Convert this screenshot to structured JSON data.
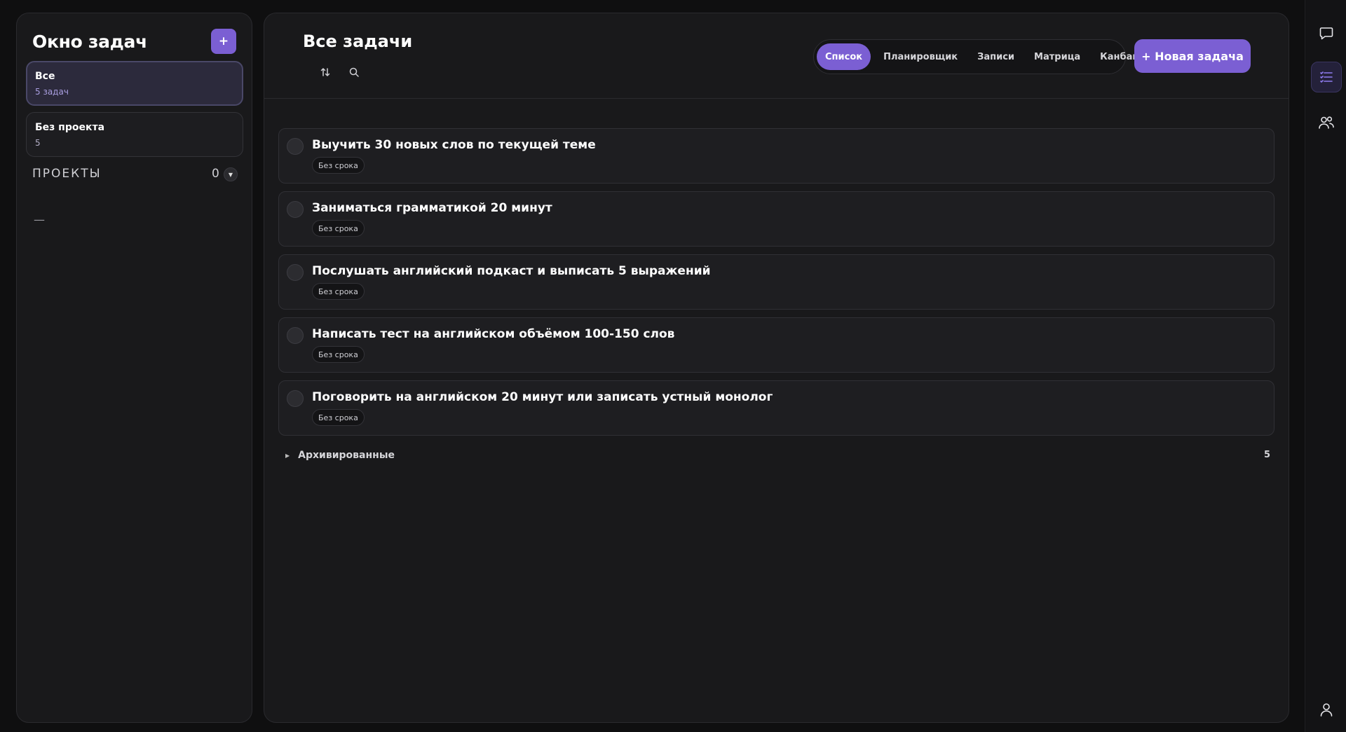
{
  "sidebar": {
    "title": "Окно задач",
    "add_label": "+",
    "filters": [
      {
        "label": "Все",
        "sub": "5 задач"
      },
      {
        "label": "Без проекта",
        "sub": "5"
      }
    ],
    "projects_label": "ПРОЕКТЫ",
    "projects_count": "0",
    "projects_empty": "—"
  },
  "header": {
    "title": "Все задачи",
    "view_tabs": [
      "Список",
      "Планировщик",
      "Записи",
      "Матрица",
      "Канбан"
    ],
    "active_view": "Список",
    "new_task_label": "+ Новая задача"
  },
  "tasks": [
    {
      "title": "Выучить 30 новых слов по текущей теме",
      "tag": "Без срока"
    },
    {
      "title": "Заниматься грамматикой 20 минут",
      "tag": "Без срока"
    },
    {
      "title": "Послушать английский подкаст и выписать 5 выражений",
      "tag": "Без срока"
    },
    {
      "title": "Написать тест на английском объёмом 100-150 слов",
      "tag": "Без срока"
    },
    {
      "title": "Поговорить на английском 20 минут или записать устный монолог",
      "tag": "Без срока"
    }
  ],
  "archived": {
    "label": "Архивированные",
    "count": "5"
  },
  "rail": {
    "items": [
      "chat-icon",
      "task-list-icon",
      "people-icon"
    ],
    "bottom": "user-icon"
  },
  "colors": {
    "accent": "#7b5fd3",
    "background": "#0f0f10",
    "panel": "#19191b"
  }
}
